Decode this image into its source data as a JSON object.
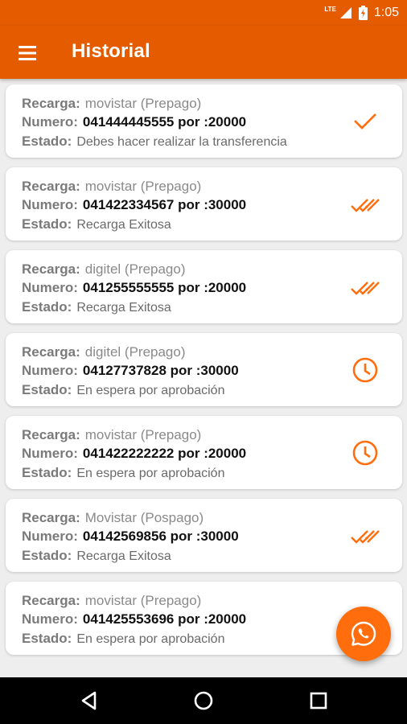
{
  "status_bar": {
    "network": "LTE",
    "time": "1:05"
  },
  "app_bar": {
    "title": "Historial"
  },
  "labels": {
    "recarga": "Recarga:",
    "numero": "Numero:",
    "estado": "Estado:"
  },
  "items": [
    {
      "operator": "movistar (Prepago)",
      "number": "041444445555 por :20000",
      "status": "Debes hacer realizar la transferencia",
      "icon": "check-icon"
    },
    {
      "operator": "movistar (Prepago)",
      "number": "041422334567 por :30000",
      "status": "Recarga Exitosa",
      "icon": "double-check-icon"
    },
    {
      "operator": "digitel (Prepago)",
      "number": "041255555555 por :20000",
      "status": "Recarga Exitosa",
      "icon": "double-check-icon"
    },
    {
      "operator": "digitel (Prepago)",
      "number": "04127737828 por :30000",
      "status": "En espera por aprobación",
      "icon": "clock-icon"
    },
    {
      "operator": "movistar (Prepago)",
      "number": "041422222222 por :20000",
      "status": "En espera por aprobación",
      "icon": "clock-icon"
    },
    {
      "operator": "Movistar (Pospago)",
      "number": "04142569856 por :30000",
      "status": "Recarga Exitosa",
      "icon": "double-check-icon"
    },
    {
      "operator": "movistar (Prepago)",
      "number": "041425553696 por :20000",
      "status": "En espera por aprobación",
      "icon": "none"
    }
  ],
  "fab": {
    "icon": "whatsapp-icon"
  },
  "nav_bar": {
    "icons": [
      "back-icon",
      "home-icon",
      "recents-icon"
    ]
  },
  "colors": {
    "primary": "#e55b00",
    "accent": "#ff6d0d",
    "icon": "#ff6d0d"
  }
}
